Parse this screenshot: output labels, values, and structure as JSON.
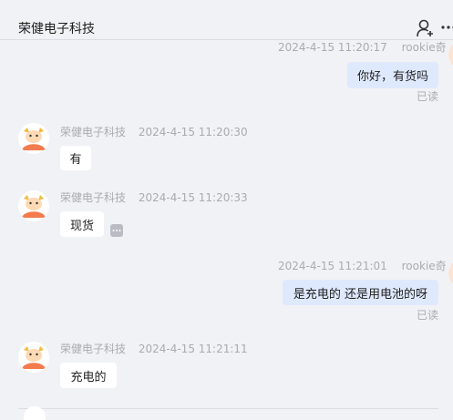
{
  "header": {
    "title": "荣健电子科技",
    "user_icon": "user-add-icon",
    "more_icon": "more-icon"
  },
  "messages": [
    {
      "sender": "rookie奇",
      "time": "2024-4-15 11:20:17",
      "text": "你好，有货吗",
      "status": "已读",
      "direction": "sent"
    },
    {
      "sender": "荣健电子科技",
      "time": "2024-4-15 11:20:30",
      "text": "有",
      "direction": "received"
    },
    {
      "sender": "荣健电子科技",
      "time": "2024-4-15 11:20:33",
      "text": "现货",
      "direction": "received"
    },
    {
      "sender": "rookie奇",
      "time": "2024-4-15 11:21:01",
      "text": "是充电的 还是用电池的呀",
      "status": "已读",
      "direction": "sent"
    },
    {
      "sender": "荣健电子科技",
      "time": "2024-4-15 11:21:11",
      "text": "充电的",
      "direction": "received"
    }
  ],
  "colors": {
    "background": "#f1f2f5",
    "sent_bubble": "#dfe9fd",
    "received_bubble": "#ffffff",
    "meta_text": "#a9abb0",
    "avatar_accent": "#f47b4d"
  }
}
